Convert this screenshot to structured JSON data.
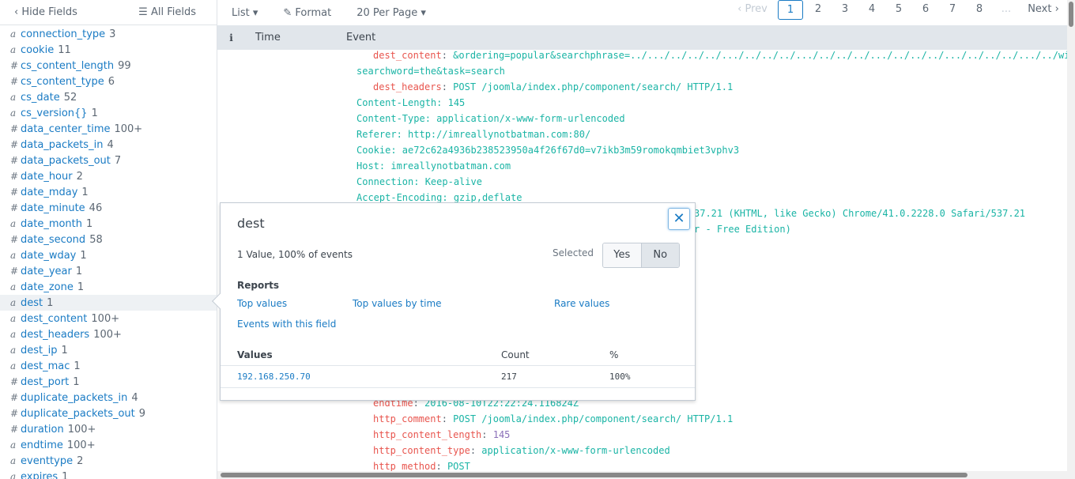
{
  "sidebar": {
    "hide_fields": "Hide Fields",
    "all_fields": "All Fields",
    "fields": [
      {
        "type": "a",
        "name": "connection_type",
        "count": "3"
      },
      {
        "type": "a",
        "name": "cookie",
        "count": "11"
      },
      {
        "type": "#",
        "name": "cs_content_length",
        "count": "99"
      },
      {
        "type": "#",
        "name": "cs_content_type",
        "count": "6"
      },
      {
        "type": "a",
        "name": "cs_date",
        "count": "52"
      },
      {
        "type": "a",
        "name": "cs_version{}",
        "count": "1"
      },
      {
        "type": "#",
        "name": "data_center_time",
        "count": "100+"
      },
      {
        "type": "#",
        "name": "data_packets_in",
        "count": "4"
      },
      {
        "type": "#",
        "name": "data_packets_out",
        "count": "7"
      },
      {
        "type": "#",
        "name": "date_hour",
        "count": "2"
      },
      {
        "type": "#",
        "name": "date_mday",
        "count": "1"
      },
      {
        "type": "#",
        "name": "date_minute",
        "count": "46"
      },
      {
        "type": "a",
        "name": "date_month",
        "count": "1"
      },
      {
        "type": "#",
        "name": "date_second",
        "count": "58"
      },
      {
        "type": "a",
        "name": "date_wday",
        "count": "1"
      },
      {
        "type": "#",
        "name": "date_year",
        "count": "1"
      },
      {
        "type": "a",
        "name": "date_zone",
        "count": "1"
      },
      {
        "type": "a",
        "name": "dest",
        "count": "1",
        "selected": true
      },
      {
        "type": "a",
        "name": "dest_content",
        "count": "100+"
      },
      {
        "type": "a",
        "name": "dest_headers",
        "count": "100+"
      },
      {
        "type": "a",
        "name": "dest_ip",
        "count": "1"
      },
      {
        "type": "a",
        "name": "dest_mac",
        "count": "1"
      },
      {
        "type": "#",
        "name": "dest_port",
        "count": "1"
      },
      {
        "type": "#",
        "name": "duplicate_packets_in",
        "count": "4"
      },
      {
        "type": "#",
        "name": "duplicate_packets_out",
        "count": "9"
      },
      {
        "type": "#",
        "name": "duration",
        "count": "100+"
      },
      {
        "type": "a",
        "name": "endtime",
        "count": "100+"
      },
      {
        "type": "a",
        "name": "eventtype",
        "count": "2"
      },
      {
        "type": "a",
        "name": "expires",
        "count": "1"
      }
    ]
  },
  "toolbar": {
    "list": "List ▾",
    "format": "Format",
    "per_page": "20 Per Page ▾"
  },
  "pager": {
    "prev": "‹ Prev",
    "pages": [
      "1",
      "2",
      "3",
      "4",
      "5",
      "6",
      "7",
      "8"
    ],
    "current": "1",
    "ellipsis": "...",
    "next": "Next ›"
  },
  "header": {
    "info": "i",
    "time": "Time",
    "event": "Event"
  },
  "events": [
    {
      "row": 0,
      "indent": true,
      "key": "dest_content",
      "val": "&ordering=popular&searchphrase=../.../../../../.../../../../.../../../../.../../../../.../../../../.../../windows/"
    },
    {
      "row": 1,
      "val": "searchword=the&task=search"
    },
    {
      "row": 2,
      "indent": true,
      "key": "dest_headers",
      "val": "POST /joomla/index.php/component/search/ HTTP/1.1"
    },
    {
      "row": 3,
      "val": "Content-Length: 145"
    },
    {
      "row": 4,
      "val": "Content-Type: application/x-www-form-urlencoded"
    },
    {
      "row": 5,
      "val": "Referer: http://imreallynotbatman.com:80/"
    },
    {
      "row": 6,
      "val": "Cookie: ae72c62a4936b238523950a4f26f67d0=v7ikb3m59romokqmbiet3vphv3"
    },
    {
      "row": 7,
      "val": "Host: imreallynotbatman.com"
    },
    {
      "row": 8,
      "val": "Connection: Keep-alive"
    },
    {
      "row": 9,
      "val": "Accept-Encoding: gzip,deflate"
    },
    {
      "row": 10,
      "val": "37.21 (KHTML, like Gecko) Chrome/41.0.2228.0 Safari/537.21",
      "partial": true
    },
    {
      "row": 11,
      "val": "r - Free Edition)",
      "partial": true
    },
    {
      "row": 22,
      "indent": true,
      "key": "endtime",
      "val": "2016-08-10T22:22:24.116824Z"
    },
    {
      "row": 23,
      "indent": true,
      "key": "http_comment",
      "val": "POST /joomla/index.php/component/search/ HTTP/1.1"
    },
    {
      "row": 24,
      "indent": true,
      "key": "http_content_length",
      "val": "145",
      "num": true
    },
    {
      "row": 25,
      "indent": true,
      "key": "http_content_type",
      "val": "application/x-www-form-urlencoded"
    },
    {
      "row": 26,
      "indent": true,
      "key": "http_method",
      "val": "POST"
    }
  ],
  "popup": {
    "title": "dest",
    "close": "✕",
    "summary": "1 Value, 100% of events",
    "selected_label": "Selected",
    "yes": "Yes",
    "no": "No",
    "selected_value": "No",
    "reports_label": "Reports",
    "reports": [
      "Top values",
      "Top values by time",
      "Rare values",
      "Events with this field"
    ],
    "values_header": "Values",
    "count_header": "Count",
    "pct_header": "%",
    "values": [
      {
        "value": "192.168.250.70",
        "count": "217",
        "pct": "100%"
      }
    ]
  },
  "colors": {
    "link": "#1a7bc4",
    "key": "#e8554e",
    "value": "#1ab4a5",
    "number": "#8a6fb8"
  }
}
